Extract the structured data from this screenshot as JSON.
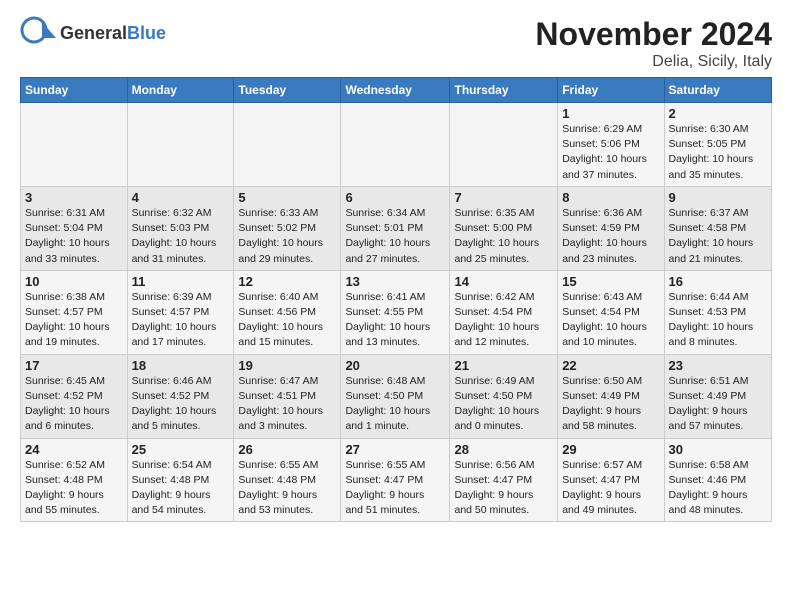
{
  "logo": {
    "general": "General",
    "blue": "Blue"
  },
  "title": "November 2024",
  "subtitle": "Delia, Sicily, Italy",
  "weekdays": [
    "Sunday",
    "Monday",
    "Tuesday",
    "Wednesday",
    "Thursday",
    "Friday",
    "Saturday"
  ],
  "weeks": [
    [
      {
        "day": "",
        "info": ""
      },
      {
        "day": "",
        "info": ""
      },
      {
        "day": "",
        "info": ""
      },
      {
        "day": "",
        "info": ""
      },
      {
        "day": "",
        "info": ""
      },
      {
        "day": "1",
        "info": "Sunrise: 6:29 AM\nSunset: 5:06 PM\nDaylight: 10 hours\nand 37 minutes."
      },
      {
        "day": "2",
        "info": "Sunrise: 6:30 AM\nSunset: 5:05 PM\nDaylight: 10 hours\nand 35 minutes."
      }
    ],
    [
      {
        "day": "3",
        "info": "Sunrise: 6:31 AM\nSunset: 5:04 PM\nDaylight: 10 hours\nand 33 minutes."
      },
      {
        "day": "4",
        "info": "Sunrise: 6:32 AM\nSunset: 5:03 PM\nDaylight: 10 hours\nand 31 minutes."
      },
      {
        "day": "5",
        "info": "Sunrise: 6:33 AM\nSunset: 5:02 PM\nDaylight: 10 hours\nand 29 minutes."
      },
      {
        "day": "6",
        "info": "Sunrise: 6:34 AM\nSunset: 5:01 PM\nDaylight: 10 hours\nand 27 minutes."
      },
      {
        "day": "7",
        "info": "Sunrise: 6:35 AM\nSunset: 5:00 PM\nDaylight: 10 hours\nand 25 minutes."
      },
      {
        "day": "8",
        "info": "Sunrise: 6:36 AM\nSunset: 4:59 PM\nDaylight: 10 hours\nand 23 minutes."
      },
      {
        "day": "9",
        "info": "Sunrise: 6:37 AM\nSunset: 4:58 PM\nDaylight: 10 hours\nand 21 minutes."
      }
    ],
    [
      {
        "day": "10",
        "info": "Sunrise: 6:38 AM\nSunset: 4:57 PM\nDaylight: 10 hours\nand 19 minutes."
      },
      {
        "day": "11",
        "info": "Sunrise: 6:39 AM\nSunset: 4:57 PM\nDaylight: 10 hours\nand 17 minutes."
      },
      {
        "day": "12",
        "info": "Sunrise: 6:40 AM\nSunset: 4:56 PM\nDaylight: 10 hours\nand 15 minutes."
      },
      {
        "day": "13",
        "info": "Sunrise: 6:41 AM\nSunset: 4:55 PM\nDaylight: 10 hours\nand 13 minutes."
      },
      {
        "day": "14",
        "info": "Sunrise: 6:42 AM\nSunset: 4:54 PM\nDaylight: 10 hours\nand 12 minutes."
      },
      {
        "day": "15",
        "info": "Sunrise: 6:43 AM\nSunset: 4:54 PM\nDaylight: 10 hours\nand 10 minutes."
      },
      {
        "day": "16",
        "info": "Sunrise: 6:44 AM\nSunset: 4:53 PM\nDaylight: 10 hours\nand 8 minutes."
      }
    ],
    [
      {
        "day": "17",
        "info": "Sunrise: 6:45 AM\nSunset: 4:52 PM\nDaylight: 10 hours\nand 6 minutes."
      },
      {
        "day": "18",
        "info": "Sunrise: 6:46 AM\nSunset: 4:52 PM\nDaylight: 10 hours\nand 5 minutes."
      },
      {
        "day": "19",
        "info": "Sunrise: 6:47 AM\nSunset: 4:51 PM\nDaylight: 10 hours\nand 3 minutes."
      },
      {
        "day": "20",
        "info": "Sunrise: 6:48 AM\nSunset: 4:50 PM\nDaylight: 10 hours\nand 1 minute."
      },
      {
        "day": "21",
        "info": "Sunrise: 6:49 AM\nSunset: 4:50 PM\nDaylight: 10 hours\nand 0 minutes."
      },
      {
        "day": "22",
        "info": "Sunrise: 6:50 AM\nSunset: 4:49 PM\nDaylight: 9 hours\nand 58 minutes."
      },
      {
        "day": "23",
        "info": "Sunrise: 6:51 AM\nSunset: 4:49 PM\nDaylight: 9 hours\nand 57 minutes."
      }
    ],
    [
      {
        "day": "24",
        "info": "Sunrise: 6:52 AM\nSunset: 4:48 PM\nDaylight: 9 hours\nand 55 minutes."
      },
      {
        "day": "25",
        "info": "Sunrise: 6:54 AM\nSunset: 4:48 PM\nDaylight: 9 hours\nand 54 minutes."
      },
      {
        "day": "26",
        "info": "Sunrise: 6:55 AM\nSunset: 4:48 PM\nDaylight: 9 hours\nand 53 minutes."
      },
      {
        "day": "27",
        "info": "Sunrise: 6:55 AM\nSunset: 4:47 PM\nDaylight: 9 hours\nand 51 minutes."
      },
      {
        "day": "28",
        "info": "Sunrise: 6:56 AM\nSunset: 4:47 PM\nDaylight: 9 hours\nand 50 minutes."
      },
      {
        "day": "29",
        "info": "Sunrise: 6:57 AM\nSunset: 4:47 PM\nDaylight: 9 hours\nand 49 minutes."
      },
      {
        "day": "30",
        "info": "Sunrise: 6:58 AM\nSunset: 4:46 PM\nDaylight: 9 hours\nand 48 minutes."
      }
    ]
  ]
}
